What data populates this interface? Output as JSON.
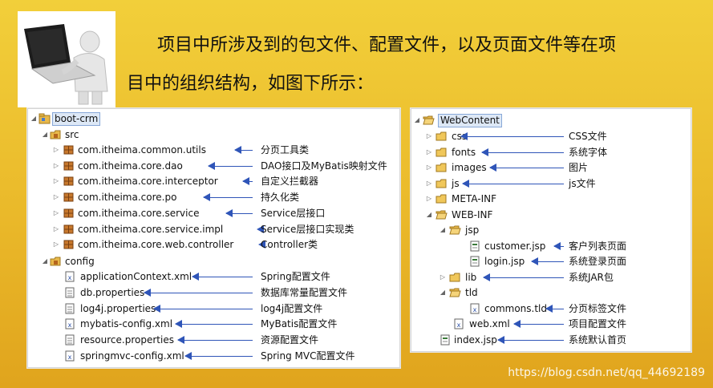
{
  "heading": {
    "line1": "项目中所涉及到的包文件、配置文件，以及页面文件等在项",
    "line2": "目中的组织结构，如图下所示："
  },
  "left_tree": {
    "root": "boot-crm",
    "src": "src",
    "packages": [
      "com.itheima.common.utils",
      "com.itheima.core.dao",
      "com.itheima.core.interceptor",
      "com.itheima.core.po",
      "com.itheima.core.service",
      "com.itheima.core.service.impl",
      "com.itheima.core.web.controller"
    ],
    "package_notes": [
      "分页工具类",
      "DAO接口及MyBatis映射文件",
      "自定义拦截器",
      "持久化类",
      "Service层接口",
      "Service层接口实现类",
      "Controller类"
    ],
    "config": "config",
    "config_files": [
      "applicationContext.xml",
      "db.properties",
      "log4j.properties",
      "mybatis-config.xml",
      "resource.properties",
      "springmvc-config.xml"
    ],
    "config_notes": [
      "Spring配置文件",
      "数据库常量配置文件",
      "log4j配置文件",
      "MyBatis配置文件",
      "资源配置文件",
      "Spring  MVC配置文件"
    ]
  },
  "right_tree": {
    "root": "WebContent",
    "css": "css",
    "fonts": "fonts",
    "images": "images",
    "js": "js",
    "meta_inf": "META-INF",
    "web_inf": "WEB-INF",
    "jsp": "jsp",
    "customer_jsp": "customer.jsp",
    "login_jsp": "login.jsp",
    "lib": "lib",
    "tld": "tld",
    "commons_tld": "commons.tld",
    "web_xml": "web.xml",
    "index_jsp": "index.jsp",
    "notes": {
      "css": "CSS文件",
      "fonts": "系统字体",
      "images": "图片",
      "js": "js文件",
      "customer_jsp": "客户列表页面",
      "login_jsp": "系统登录页面",
      "lib": "系统JAR包",
      "commons_tld": "分页标签文件",
      "web_xml": "项目配置文件",
      "index_jsp": "系统默认首页"
    }
  },
  "watermark": "https://blog.csdn.net/qq_44692189",
  "colors": {
    "arrow": "#2f55b8",
    "folder": "#e8b84a",
    "package": "#b5651d"
  },
  "icons": [
    "laptop-person-clipart",
    "project-icon",
    "source-folder-icon",
    "package-icon",
    "xml-file-icon",
    "properties-file-icon",
    "folder-icon",
    "jsp-file-icon"
  ]
}
